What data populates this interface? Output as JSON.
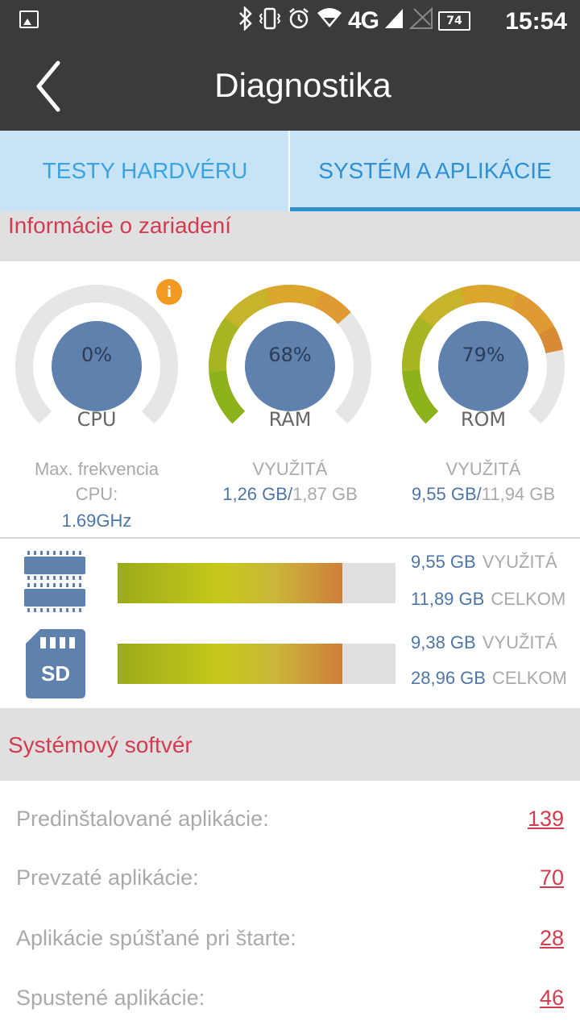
{
  "status_bar": {
    "network": "4G",
    "battery": "74",
    "time": "15:54",
    "icons": [
      "gallery-icon",
      "bluetooth-icon",
      "vibrate-icon",
      "alarm-icon",
      "wifi-icon",
      "signal-icon",
      "battery-icon"
    ]
  },
  "app_bar": {
    "title": "Diagnostika",
    "back_icon": "chevron-left-icon"
  },
  "tabs": [
    {
      "label": "TESTY HARDVÉRU",
      "active": false
    },
    {
      "label": "SYSTÉM A APLIKÁCIE",
      "active": true
    }
  ],
  "device_info": {
    "header": "Informácie o zariadení",
    "gauges": [
      {
        "label": "CPU",
        "percent_text": "0%",
        "percent": 0,
        "caption_line1": "Max. frekvencia",
        "caption_line2": "CPU:",
        "caption_value": "1.69GHz"
      },
      {
        "label": "RAM",
        "percent_text": "68%",
        "percent": 68,
        "caption": "VYUŽITÁ",
        "used": "1,26 GB",
        "separator": "/",
        "total": "1,87 GB"
      },
      {
        "label": "ROM",
        "percent_text": "79%",
        "percent": 79,
        "caption": "VYUŽITÁ",
        "used": "9,55 GB",
        "separator": "/",
        "total": "11,94 GB"
      }
    ],
    "storage": [
      {
        "icon": "memory-chip-icon",
        "used_value": "9,55 GB",
        "used_label": "VYUŽITÁ",
        "total_value": "11,89 GB",
        "total_label": "CELKOM",
        "fill_fraction": 0.81
      },
      {
        "icon": "sd-card-icon",
        "icon_text": "SD",
        "used_value": "9,38 GB",
        "used_label": "VYUŽITÁ",
        "total_value": "28,96 GB",
        "total_label": "CELKOM",
        "fill_fraction": 0.81
      }
    ]
  },
  "system_software": {
    "header": "Systémový softvér",
    "rows": [
      {
        "label": "Predinštalované aplikácie:",
        "value": "139"
      },
      {
        "label": "Prevzaté aplikácie:",
        "value": "70"
      },
      {
        "label": "Aplikácie spúšťané pri štarte:",
        "value": "28"
      },
      {
        "label": "Spustené aplikácie:",
        "value": "46"
      }
    ]
  },
  "colors": {
    "bar_dark": "#3b3b3b",
    "tab_bg": "#c7e4f7",
    "tab_text": "#3aa3e0",
    "section_header_text": "#d23c50",
    "gauge_center": "#5f81ad",
    "info_badge": "#f39a22"
  }
}
